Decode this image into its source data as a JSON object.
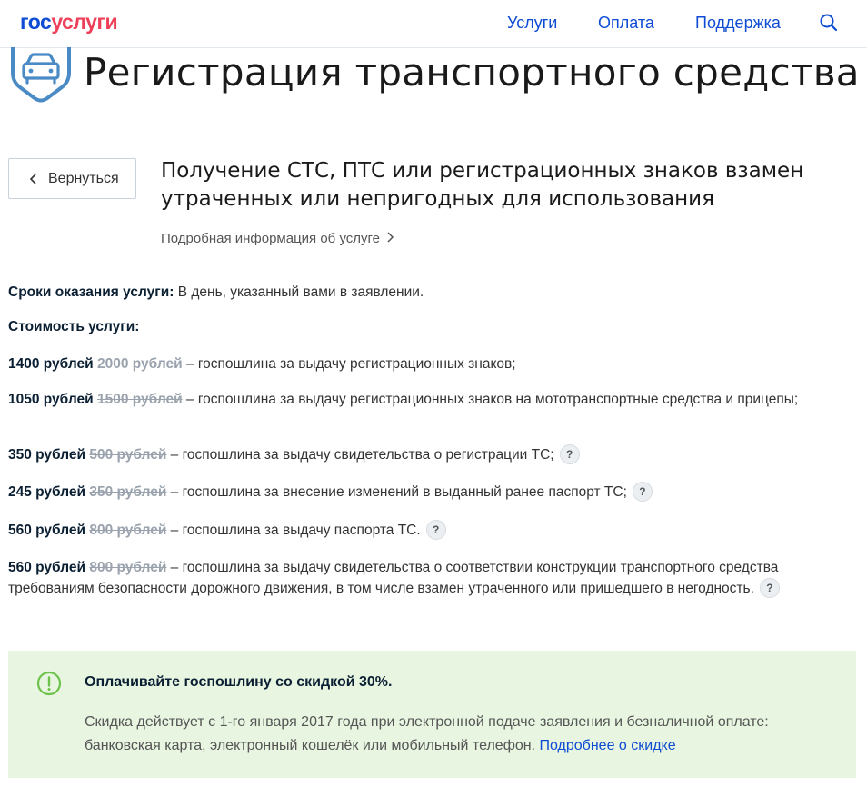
{
  "header": {
    "logo_part1": "гос",
    "logo_part2": "услуги",
    "nav": [
      "Услуги",
      "Оплата",
      "Поддержка"
    ]
  },
  "page_title": "Регистрация транспортного средства",
  "back_label": "Вернуться",
  "service": {
    "title": "Получение СТС, ПТС или регистрационных знаков взамен утраченных или непригодных для использования",
    "more_info": "Подробная информация об услуге"
  },
  "terms": {
    "label": "Сроки оказания услуги:",
    "value": " В день, указанный вами в заявлении."
  },
  "cost_label": "Стоимость услуги:",
  "fees": [
    {
      "price": "1400 рублей",
      "old": "2000 рублей",
      "desc": " – госпошлина за выдачу регистрационных знаков;"
    },
    {
      "price": "1050 рублей",
      "old": "1500 рублей",
      "desc": " – госпошлина за выдачу регистрационных знаков на мототранспортные средства и прицепы;"
    },
    {
      "price": "350 рублей",
      "old": "500 рублей",
      "desc": " – госпошлина за выдачу свидетельства о регистрации ТС;"
    },
    {
      "price": "245 рублей",
      "old": "350 рублей",
      "desc": " – госпошлина за внесение изменений в выданный ранее паспорт ТС;"
    },
    {
      "price": "560 рублей",
      "old": "800 рублей",
      "desc": " – госпошлина за выдачу паспорта ТС."
    },
    {
      "price": "560 рублей",
      "old": "800 рублей",
      "desc": " – госпошлина за выдачу свидетельства о соответствии конструкции транспортного средства требованиям безопасности дорожного движения, в том числе взамен утраченного или пришедшего в негодность."
    }
  ],
  "help_glyph": "?",
  "discount": {
    "title": "Оплачивайте госпошлину со скидкой 30%.",
    "text": "Скидка действует с 1-го января 2017 года при электронной подаче заявления и безналичной оплате: банковская карта, электронный кошелёк или мобильный телефон. ",
    "link": "Подробнее о скидке"
  },
  "colors": {
    "brand_blue": "#0d4cd3",
    "brand_red": "#ee3f58",
    "icon_blue": "#4a8bc6",
    "discount_bg": "#e8f5e1",
    "discount_icon": "#6cc24a"
  },
  "icons": {
    "search": "search-icon",
    "car": "car-icon",
    "back": "chevron-left-icon",
    "more": "chevron-right-icon",
    "help": "question-icon",
    "warning": "exclamation-circle-icon"
  }
}
